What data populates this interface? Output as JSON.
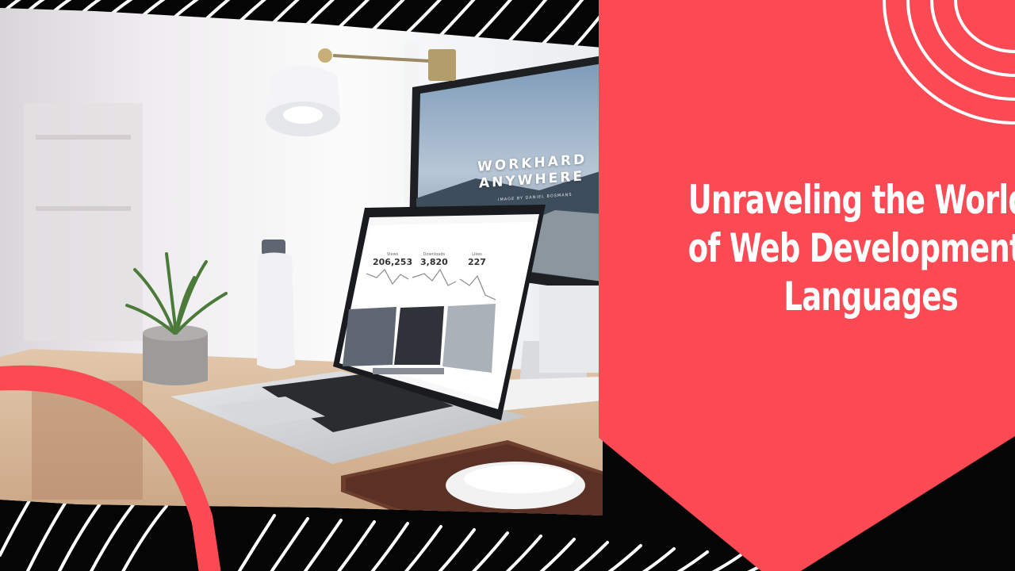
{
  "slide": {
    "title_lines": [
      "Unraveling the World",
      "of Web Development",
      "Languages"
    ]
  },
  "photo": {
    "monitor_text": [
      "WORKHARD",
      "ANYWHERE"
    ],
    "monitor_subtext": "IMAGE BY DANIEL BOSMANS",
    "dashboard_stats": [
      {
        "label": "Views",
        "value": "206,253"
      },
      {
        "label": "Downloads",
        "value": "3,820"
      },
      {
        "label": "Likes",
        "value": "227"
      }
    ]
  },
  "colors": {
    "accent": "#fb4a53",
    "background": "#050505",
    "stripe": "#ffffff",
    "title_text": "#ffffff"
  }
}
